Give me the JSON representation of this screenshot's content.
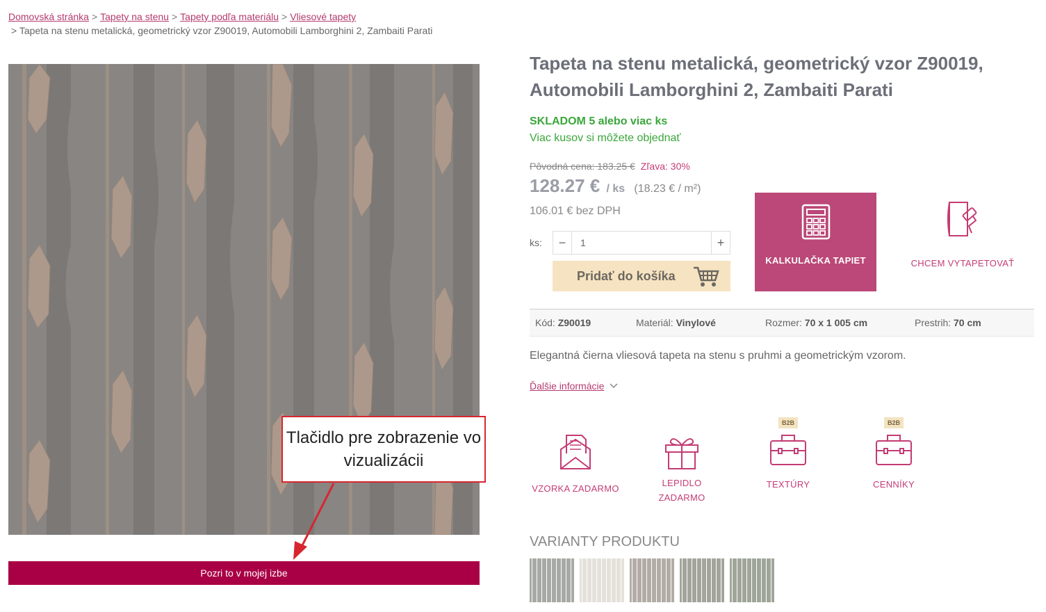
{
  "breadcrumb": {
    "items": [
      "Domovská stránka",
      "Tapety na stenu",
      "Tapety podľa materiálu",
      "Vliesové tapety"
    ],
    "separator": ">",
    "current": "> Tapeta na stenu metalická, geometrický vzor Z90019, Automobili Lamborghini 2, Zambaiti Parati"
  },
  "product": {
    "title": "Tapeta na stenu metalická, geometrický vzor Z90019, Automobili Lamborghini 2, Zambaiti Parati",
    "stock": "SKLADOM 5 alebo viac ks",
    "stock_note": "Viac kusov si môžete objednať",
    "old_price": "Pôvodná cena: 183.25 €",
    "discount": "Zľava: 30%",
    "price": "128.27 €",
    "price_unit": "/ ks",
    "price_per_m2": "(18.23 € / m²)",
    "price_net": "106.01 € bez DPH"
  },
  "quantity": {
    "label": "ks:",
    "minus": "−",
    "plus": "+",
    "value": "1"
  },
  "buttons": {
    "add_to_cart": "Pridať do košíka",
    "calculator": "KALKULAČKA TAPIET",
    "wallpapering": "CHCEM VYTAPETOVAŤ",
    "view_in_room": "Pozri to v mojej izbe"
  },
  "specs": {
    "code_label": "Kód:",
    "code": "Z90019",
    "material_label": "Materiál:",
    "material": "Vinylové",
    "size_label": "Rozmer:",
    "size": "70 x 1 005 cm",
    "repeat_label": "Prestrih:",
    "repeat": "70 cm"
  },
  "description": "Elegantná čierna vliesová tapeta na stenu s pruhmi a geometrickým vzorom.",
  "more_info": "Ďalšie informácie",
  "benefits": [
    {
      "label": "VZORKA ZADARMO",
      "badge": "",
      "icon": "envelope-letter-icon"
    },
    {
      "label": "LEPIDLO ZADARMO",
      "badge": "",
      "icon": "gift-icon"
    },
    {
      "label": "TEXTÚRY",
      "badge": "B2B",
      "icon": "briefcase-icon"
    },
    {
      "label": "CENNÍKY",
      "badge": "B2B",
      "icon": "briefcase-icon"
    }
  ],
  "annotation": {
    "text": "Tlačidlo pre zobrazenie vo vizualizácii",
    "color": "#d7262f"
  },
  "variants": {
    "title": "VARIANTY PRODUKTU",
    "swatches": [
      "#a7a9a4",
      "#e3e1da",
      "#b2aca6",
      "#a3a59c",
      "#9fa699"
    ]
  },
  "colors": {
    "accent": "#bb4878",
    "cta_dark": "#a90045",
    "stock_green": "#3aa63a",
    "cart_button": "#f6e3c1"
  }
}
